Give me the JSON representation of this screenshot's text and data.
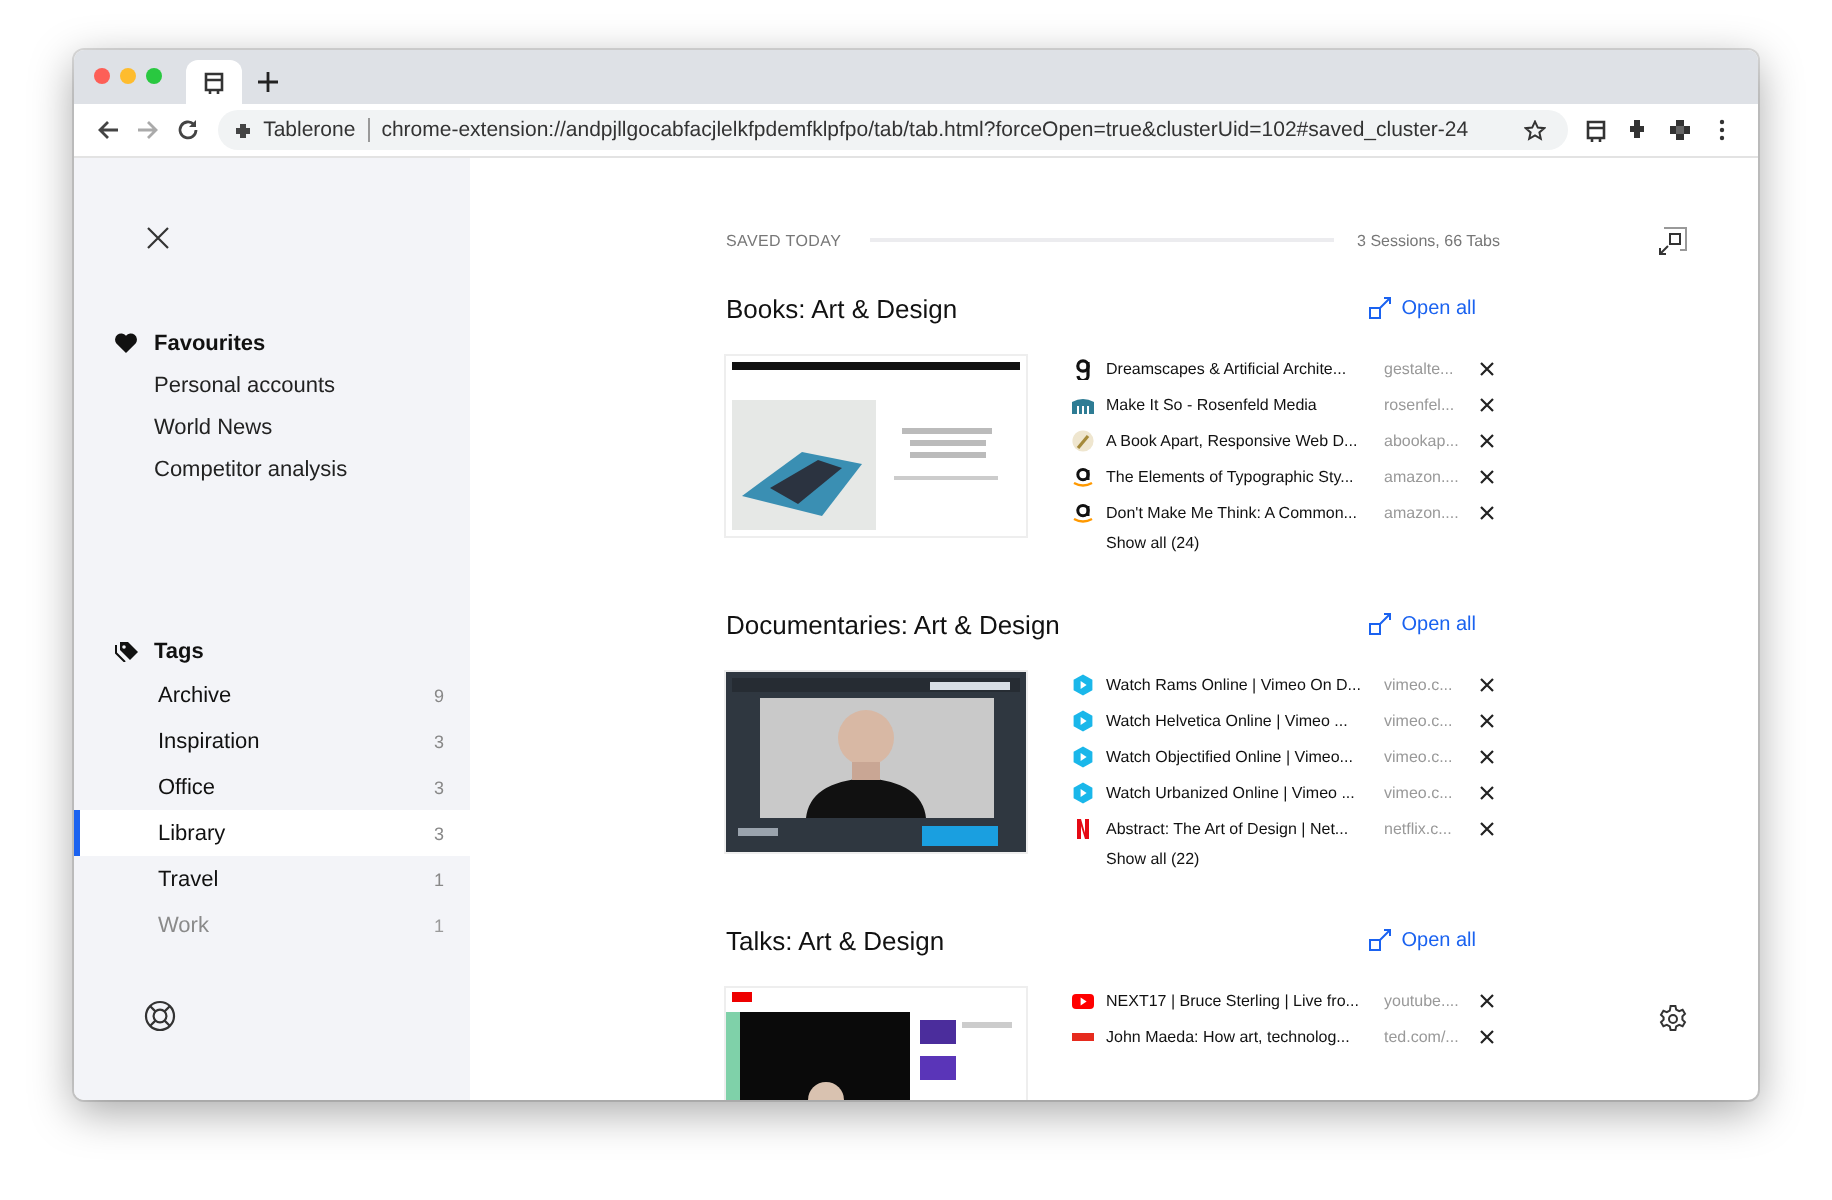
{
  "browser": {
    "tabs": [
      {
        "kind": "app",
        "selected": true
      },
      {
        "kind": "new",
        "selected": false
      }
    ],
    "omnibox": {
      "site": "Tablerone",
      "url": "chrome-extension://andpjllgocabfacjlelkfpdemfklpfpo/tab/tab.html?forceOpen=true&clusterUid=102#saved_cluster-24"
    }
  },
  "sidebar": {
    "favourites": {
      "title": "Favourites",
      "items": [
        "Personal accounts",
        "World News",
        "Competitor analysis"
      ]
    },
    "tags": {
      "title": "Tags",
      "items": [
        {
          "label": "Archive",
          "count": "9",
          "selected": false,
          "faded": false
        },
        {
          "label": "Inspiration",
          "count": "3",
          "selected": false,
          "faded": false
        },
        {
          "label": "Office",
          "count": "3",
          "selected": false,
          "faded": false
        },
        {
          "label": "Library",
          "count": "3",
          "selected": true,
          "faded": false
        },
        {
          "label": "Travel",
          "count": "1",
          "selected": false,
          "faded": false
        },
        {
          "label": "Work",
          "count": "1",
          "selected": false,
          "faded": true
        }
      ]
    }
  },
  "main": {
    "section_label": "SAVED TODAY",
    "summary": "3 Sessions, 66 Tabs",
    "groups": [
      {
        "title": "Books: Art & Design",
        "open_all": "Open all",
        "thumbnail": {
          "kind": "books"
        },
        "show_all": "Show all (24)",
        "tabs": [
          {
            "kind": "gestalten",
            "title": "Dreamscapes & Artificial Archite...",
            "domain": "gestalte..."
          },
          {
            "kind": "rosenfeld",
            "title": "Make It So - Rosenfeld Media",
            "domain": "rosenfel..."
          },
          {
            "kind": "abookapart",
            "title": "A Book Apart, Responsive Web D...",
            "domain": "abookap..."
          },
          {
            "kind": "amazon",
            "title": "The Elements of Typographic Sty...",
            "domain": "amazon...."
          },
          {
            "kind": "amazon",
            "title": "Don't Make Me Think: A Common...",
            "domain": "amazon...."
          }
        ]
      },
      {
        "title": "Documentaries: Art & Design",
        "open_all": "Open all",
        "thumbnail": {
          "kind": "video"
        },
        "show_all": "Show all (22)",
        "tabs": [
          {
            "kind": "vimeo",
            "title": "Watch Rams Online | Vimeo On D...",
            "domain": "vimeo.c..."
          },
          {
            "kind": "vimeo",
            "title": "Watch Helvetica Online | Vimeo ...",
            "domain": "vimeo.c..."
          },
          {
            "kind": "vimeo",
            "title": "Watch Objectified Online | Vimeo...",
            "domain": "vimeo.c..."
          },
          {
            "kind": "vimeo",
            "title": "Watch Urbanized Online | Vimeo ...",
            "domain": "vimeo.c..."
          },
          {
            "kind": "netflix",
            "title": "Abstract: The Art of Design | Net...",
            "domain": "netflix.c..."
          }
        ]
      },
      {
        "title": "Talks: Art & Design",
        "open_all": "Open all",
        "thumbnail": {
          "kind": "talk"
        },
        "tabs": [
          {
            "kind": "youtube",
            "title": "NEXT17 | Bruce Sterling | Live fro...",
            "domain": "youtube...."
          },
          {
            "kind": "ted",
            "title": "John Maeda: How art, technolog...",
            "domain": "ted.com/..."
          }
        ]
      }
    ]
  }
}
